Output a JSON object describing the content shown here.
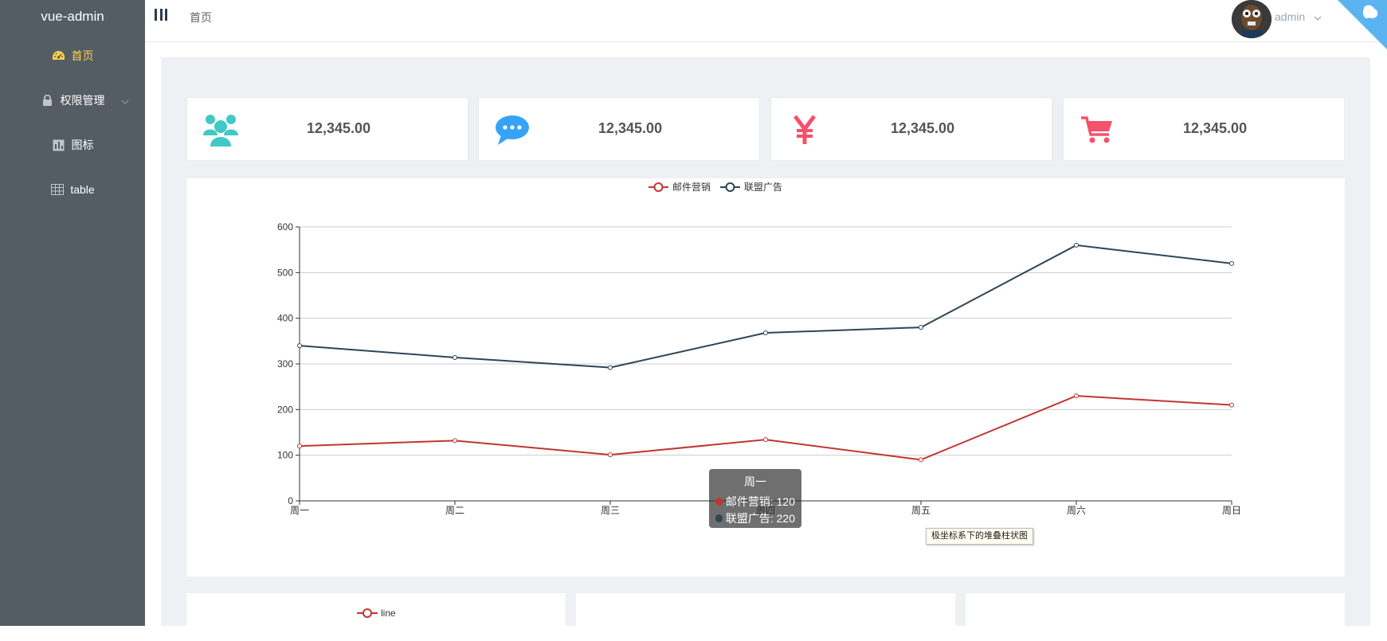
{
  "sidebar": {
    "brand": "vue-admin",
    "items": [
      {
        "label": "首页",
        "icon": "dashboard-icon",
        "active": true
      },
      {
        "label": "权限管理",
        "icon": "lock-icon",
        "has_submenu": true
      },
      {
        "label": "图标",
        "icon": "chart-icon"
      },
      {
        "label": "table",
        "icon": "table-icon"
      }
    ]
  },
  "header": {
    "breadcrumb": "首页",
    "username": "admin"
  },
  "panels": [
    {
      "icon": "people-icon",
      "value": "12,345.00",
      "color": "#34bfa3"
    },
    {
      "icon": "message-icon",
      "value": "12,345.00",
      "color": "#36a3f7"
    },
    {
      "icon": "yen-icon",
      "value": "12,345.00",
      "color": "#f4516c"
    },
    {
      "icon": "shopping-cart-icon",
      "value": "12,345.00",
      "color": "#f45a2f"
    }
  ],
  "chart_data": {
    "type": "line",
    "categories": [
      "周一",
      "周二",
      "周三",
      "周四",
      "周五",
      "周六",
      "周日"
    ],
    "series": [
      {
        "name": "邮件营销",
        "values": [
          120,
          132,
          101,
          134,
          90,
          230,
          210
        ],
        "color": "#c23531"
      },
      {
        "name": "联盟广告",
        "values": [
          340,
          314,
          292,
          368,
          380,
          560,
          520
        ],
        "color": "#2f4554"
      }
    ],
    "ylim": [
      0,
      600
    ],
    "yticks": [
      0,
      100,
      200,
      300,
      400,
      500,
      600
    ],
    "grid": true,
    "legend": "top-center"
  },
  "tooltip": {
    "title": "周一",
    "rows": [
      {
        "series": "邮件营销",
        "value": "120",
        "color": "#c23531"
      },
      {
        "series": "联盟广告",
        "value": "220",
        "color": "#2f4554"
      }
    ]
  },
  "hover_tip": "极坐标系下的堆叠柱状图",
  "bottom_charts": [
    {
      "legend": "line"
    }
  ]
}
